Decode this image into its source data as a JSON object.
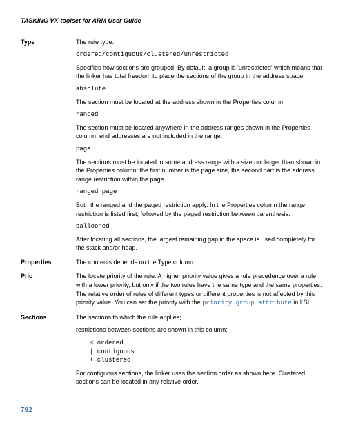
{
  "header": "TASKING VX-toolset for ARM User Guide",
  "sections": {
    "type": {
      "label": "Type",
      "intro": "The rule type:",
      "code1": "ordered/contiguous/clustered/unrestricted",
      "p1": "Specifies how sections are grouped. By default, a group is 'unrestricted' which means that the linker has total freedom to place the sections of the group in the address space.",
      "code2": "absolute",
      "p2": "The section must be located at the address shown in the Properties column.",
      "code3": "ranged",
      "p3": "The section must be located anywhere in the address ranges shown in the Properties column; end addresses are not included in the range.",
      "code4": "page",
      "p4": "The sections must be located in some address range with a size not larger than shown in the Properties column; the first number is the page size, the second part is the address range restriction within the page.",
      "code5": "ranged page",
      "p5": "Both the ranged and the paged restriction apply. In the Properties column the range restriction is listed first, followed by the paged restriction between parenthesis.",
      "code6": "ballooned",
      "p6": "After locating all sections, the largest remaining gap in the space is used completely for the stack and/or heap."
    },
    "properties": {
      "label": "Properties",
      "text": "The contents depends on the Type column."
    },
    "prio": {
      "label": "Prio",
      "text_a": "The locate priority of the rule. A higher priority value gives a rule precedence over a rule with a lower priority, but only if the two rules have the same type and the same properties. The relative order of rules of different types or different properties is not affected by this priority value. You can set the priority with the ",
      "code": "priority group attribute",
      "text_b": " in LSL."
    },
    "sectionsrow": {
      "label": "Sections",
      "p1": "The sections to which the rule applies;",
      "p2": "restrictions between sections are shown in this column:",
      "list1": "<   ordered",
      "list2": "|   contiguous",
      "list3": "+   clustered",
      "p3": "For contiguous sections, the linker uses the section order as shown here. Clustered sections can be located in any relative order."
    }
  },
  "pageNum": "792"
}
